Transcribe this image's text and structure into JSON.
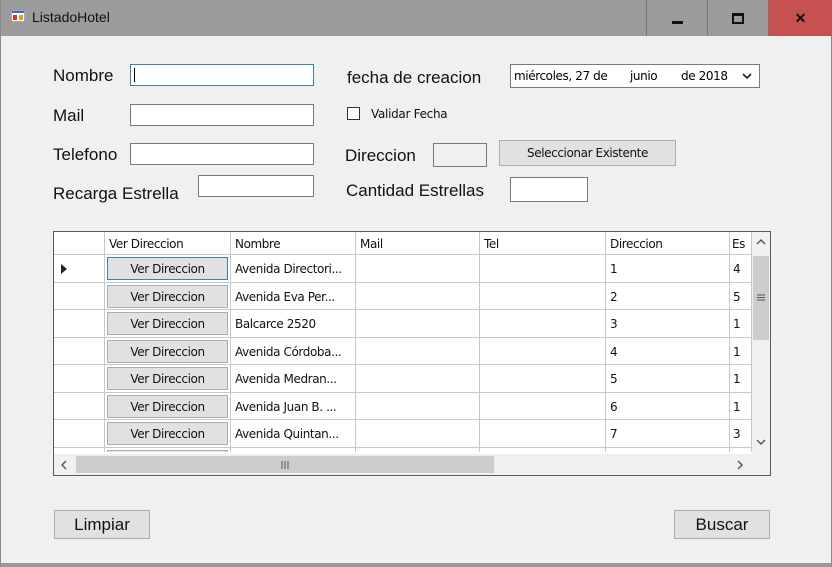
{
  "window": {
    "title": "ListadoHotel"
  },
  "form": {
    "nombre": {
      "label": "Nombre",
      "value": ""
    },
    "mail": {
      "label": "Mail",
      "value": ""
    },
    "telefono": {
      "label": "Telefono",
      "value": ""
    },
    "recarga": {
      "label": "Recarga Estrella",
      "value": ""
    },
    "fecha": {
      "label": "fecha de creacion",
      "weekday": "miércoles, 27 de",
      "month": "junio",
      "year": "de 2018"
    },
    "validar": {
      "label": "Validar Fecha",
      "checked": false
    },
    "direccion": {
      "label": "Direccion",
      "value": "",
      "button": "Seleccionar Existente"
    },
    "cantidad": {
      "label": "Cantidad Estrellas",
      "value": ""
    }
  },
  "grid": {
    "columns": [
      "Ver Direccion",
      "Nombre",
      "Mail",
      "Tel",
      "Direccion",
      "Es"
    ],
    "rows": [
      {
        "button": "Ver Direccion",
        "nombre": "Avenida Directori...",
        "mail": "",
        "tel": "",
        "direccion": "1",
        "es": "4"
      },
      {
        "button": "Ver Direccion",
        "nombre": "Avenida Eva Per...",
        "mail": "",
        "tel": "",
        "direccion": "2",
        "es": "5"
      },
      {
        "button": "Ver Direccion",
        "nombre": "Balcarce 2520",
        "mail": "",
        "tel": "",
        "direccion": "3",
        "es": "1"
      },
      {
        "button": "Ver Direccion",
        "nombre": "Avenida Córdoba...",
        "mail": "",
        "tel": "",
        "direccion": "4",
        "es": "1"
      },
      {
        "button": "Ver Direccion",
        "nombre": "Avenida Medran...",
        "mail": "",
        "tel": "",
        "direccion": "5",
        "es": "1"
      },
      {
        "button": "Ver Direccion",
        "nombre": "Avenida Juan B. ...",
        "mail": "",
        "tel": "",
        "direccion": "6",
        "es": "1"
      },
      {
        "button": "Ver Direccion",
        "nombre": "Avenida Quintan...",
        "mail": "",
        "tel": "",
        "direccion": "7",
        "es": "3"
      }
    ]
  },
  "actions": {
    "limpiar": "Limpiar",
    "buscar": "Buscar"
  },
  "colors": {
    "titlebar": "#9c9c9c",
    "close": "#c75050",
    "focus": "#3c7fb1"
  }
}
